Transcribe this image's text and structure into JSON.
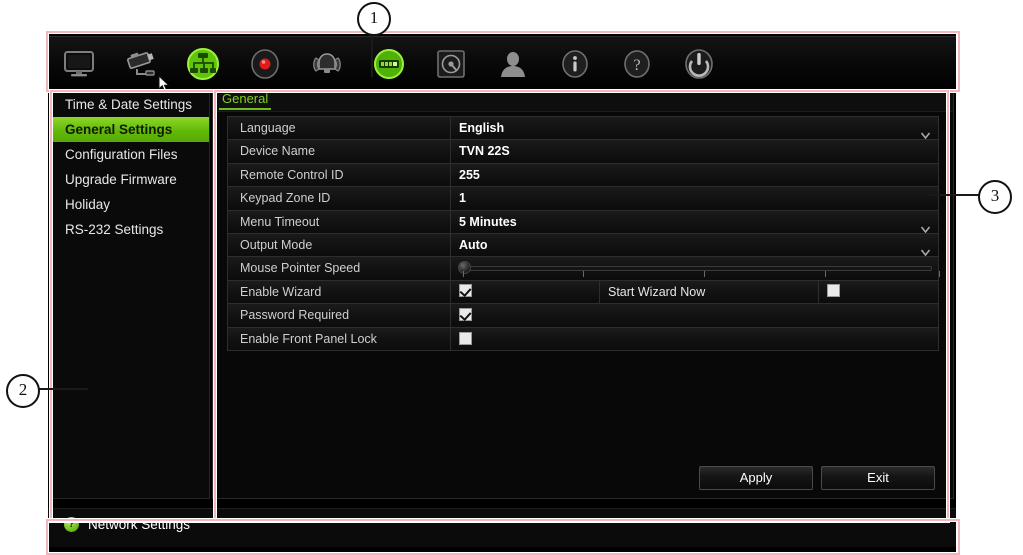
{
  "toolbar": {
    "items": [
      {
        "name": "display-icon",
        "label": "Display Settings"
      },
      {
        "name": "camera-icon",
        "label": "Camera Settings"
      },
      {
        "name": "network-icon",
        "label": "Network Settings"
      },
      {
        "name": "record-icon",
        "label": "Recording Settings"
      },
      {
        "name": "alarm-icon",
        "label": "Alarm Settings"
      },
      {
        "name": "device-settings-icon",
        "label": "Device Settings"
      },
      {
        "name": "storage-icon",
        "label": "Storage Settings"
      },
      {
        "name": "user-icon",
        "label": "User Management"
      },
      {
        "name": "info-icon",
        "label": "System Information"
      },
      {
        "name": "help-icon",
        "label": "Help"
      },
      {
        "name": "power-icon",
        "label": "Shutdown"
      }
    ],
    "selected_index": 2
  },
  "sidebar": {
    "items": [
      {
        "label": "Time & Date Settings",
        "selected": false
      },
      {
        "label": "General Settings",
        "selected": true
      },
      {
        "label": "Configuration Files",
        "selected": false
      },
      {
        "label": "Upgrade Firmware",
        "selected": false
      },
      {
        "label": "Holiday",
        "selected": false
      },
      {
        "label": "RS-232 Settings",
        "selected": false
      }
    ]
  },
  "main": {
    "tab_label": "General",
    "rows": [
      {
        "label": "Language",
        "value": "English",
        "type": "dropdown"
      },
      {
        "label": "Device Name",
        "value": "TVN 22S",
        "type": "text"
      },
      {
        "label": "Remote Control ID",
        "value": "255",
        "type": "text"
      },
      {
        "label": "Keypad Zone ID",
        "value": "1",
        "type": "text"
      },
      {
        "label": "Menu Timeout",
        "value": "5 Minutes",
        "type": "dropdown"
      },
      {
        "label": "Output Mode",
        "value": "Auto",
        "type": "dropdown"
      }
    ],
    "slider_row": {
      "label": "Mouse Pointer Speed",
      "value_percent": 0
    },
    "wizard_row": {
      "label": "Enable Wizard",
      "checked": true,
      "action_label": "Start Wizard Now",
      "action_checked": false
    },
    "check_rows": [
      {
        "label": "Password Required",
        "checked": true
      },
      {
        "label": "Enable Front Panel Lock",
        "checked": false
      }
    ],
    "buttons": {
      "apply": "Apply",
      "exit": "Exit"
    }
  },
  "status_bar": {
    "icon": "help-circle-icon",
    "icon_glyph": "?",
    "text": "Network Settings"
  },
  "callouts": [
    {
      "number": "1"
    },
    {
      "number": "2"
    },
    {
      "number": "3"
    }
  ],
  "colors": {
    "accent_green": "#7ed321",
    "selection_green": "#63ba07",
    "annotation_red": "#d95f6e",
    "panel_bg": "#080808"
  }
}
